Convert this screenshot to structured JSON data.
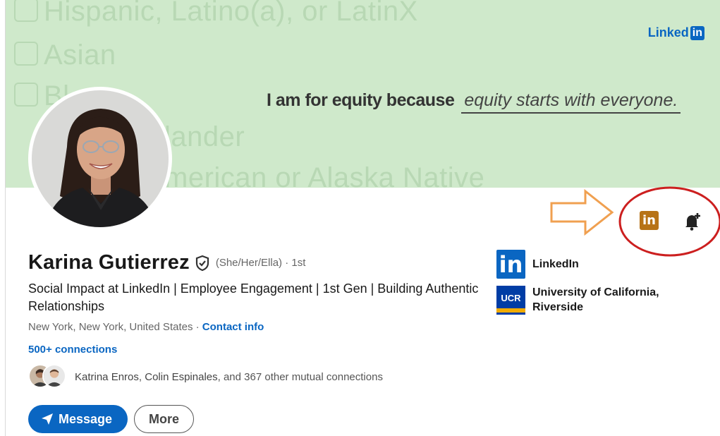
{
  "banner": {
    "background_color": "#cfe9cb",
    "bg_lines": [
      "Hispanic, Latino(a), or LatinX",
      "Asian",
      "Bl",
      "lander",
      "merican or Alaska Native"
    ],
    "logo_text": "Linked",
    "logo_box": "in",
    "tagline_lead": "I am for equity because",
    "tagline_fill": "equity starts with everyone."
  },
  "annotation": {
    "arrow_color": "#f0a050",
    "circle_color": "#cc1f1f",
    "icons": [
      "linkedin-icon",
      "bell-plus-icon"
    ],
    "li_icon_text": "in"
  },
  "profile": {
    "name": "Karina Gutierrez",
    "pronouns": "(She/Her/Ella) · 1st",
    "headline": "Social Impact at LinkedIn | Employee Engagement | 1st Gen | Building Authentic Relationships",
    "location": "New York, New York, United States · ",
    "contact_link": "Contact info",
    "connections": "500+ connections",
    "mutual_name1": "Katrina Enros",
    "mutual_sep": ", ",
    "mutual_name2": "Colin Espinales",
    "mutual_rest": ", and 367 other mutual connections",
    "message_button": "Message",
    "more_button": "More"
  },
  "companies": [
    {
      "name": "LinkedIn",
      "logo": "in"
    },
    {
      "name": "University of California, Riverside",
      "logo": "UCR"
    }
  ],
  "colors": {
    "brand_blue": "#0a66c2",
    "text_dark": "#191919",
    "text_muted": "#666666"
  }
}
